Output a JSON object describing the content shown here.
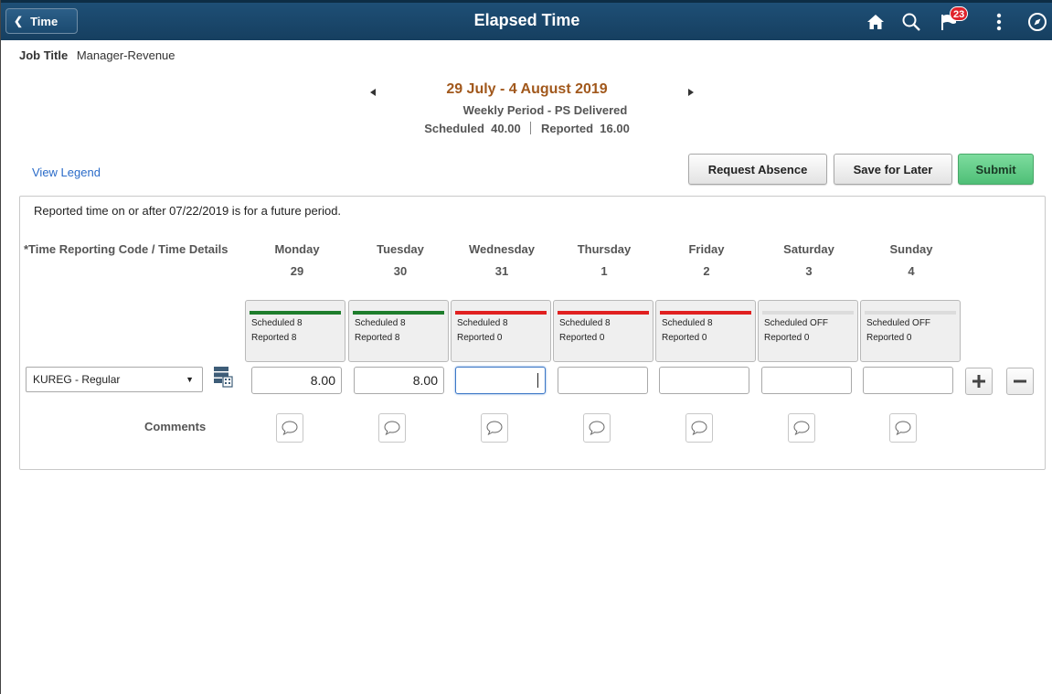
{
  "header": {
    "back_label": "Time",
    "title": "Elapsed Time",
    "icons": [
      "home-icon",
      "search-icon",
      "notifications-icon",
      "actions-menu-icon",
      "navbar-compass-icon"
    ],
    "notification_count": "23",
    "badge_color": "#e0222b"
  },
  "job": {
    "label": "Job Title",
    "value": "Manager-Revenue"
  },
  "period": {
    "title": "29 July - 4 August 2019",
    "subtitle": "Weekly Period - PS Delivered",
    "scheduled_label": "Scheduled",
    "scheduled_value": "40.00",
    "reported_label": "Reported",
    "reported_value": "16.00"
  },
  "actions": {
    "legend_link": "View Legend",
    "request_absence": "Request Absence",
    "save_for_later": "Save for Later",
    "submit": "Submit"
  },
  "grid": {
    "note": "Reported time on or after 07/22/2019 is for a future period.",
    "trc_header": "*Time Reporting Code / Time Details",
    "days": [
      {
        "name": "Monday",
        "num": "29",
        "status": "green",
        "scheduled": "Scheduled 8",
        "reported": "Reported  8",
        "hours": "8.00"
      },
      {
        "name": "Tuesday",
        "num": "30",
        "status": "green",
        "scheduled": "Scheduled 8",
        "reported": "Reported  8",
        "hours": "8.00"
      },
      {
        "name": "Wednesday",
        "num": "31",
        "status": "red",
        "scheduled": "Scheduled 8",
        "reported": "Reported  0",
        "hours": ""
      },
      {
        "name": "Thursday",
        "num": "1",
        "status": "red",
        "scheduled": "Scheduled 8",
        "reported": "Reported  0",
        "hours": ""
      },
      {
        "name": "Friday",
        "num": "2",
        "status": "red",
        "scheduled": "Scheduled 8",
        "reported": "Reported  0",
        "hours": ""
      },
      {
        "name": "Saturday",
        "num": "3",
        "status": "grey",
        "scheduled": "Scheduled OFF",
        "reported": "Reported  0",
        "hours": ""
      },
      {
        "name": "Sunday",
        "num": "4",
        "status": "grey",
        "scheduled": "Scheduled OFF",
        "reported": "Reported  0",
        "hours": ""
      }
    ],
    "trc_selected": "KUREG - Regular",
    "comments_label": "Comments",
    "status_colors": {
      "green": "#1e7d2c",
      "red": "#e02020",
      "grey": "#dcdcdc"
    }
  }
}
